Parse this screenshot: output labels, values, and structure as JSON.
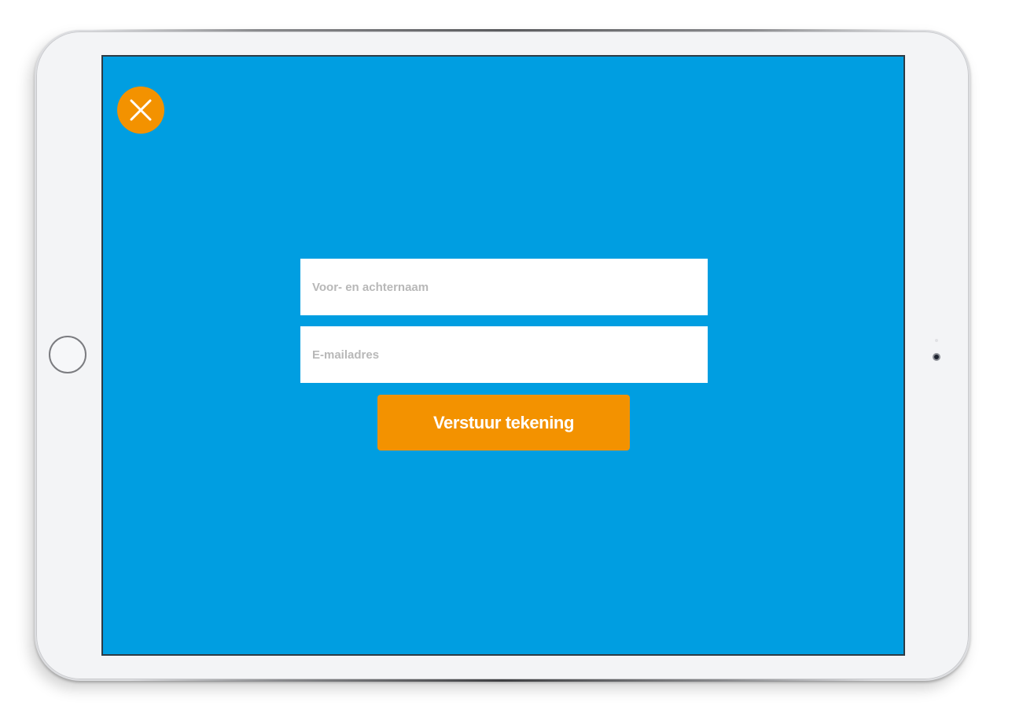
{
  "form": {
    "name_placeholder": "Voor- en achternaam",
    "name_value": "",
    "email_placeholder": "E-mailadres",
    "email_value": "",
    "submit_label": "Verstuur tekening"
  },
  "icons": {
    "close": "close-icon",
    "home": "home-button"
  },
  "colors": {
    "screen_background": "#009ee1",
    "accent": "#f39200",
    "field_background": "#ffffff",
    "placeholder_text": "#b8b8b8",
    "button_text": "#ffffff",
    "device_frame": "#f3f4f6"
  }
}
